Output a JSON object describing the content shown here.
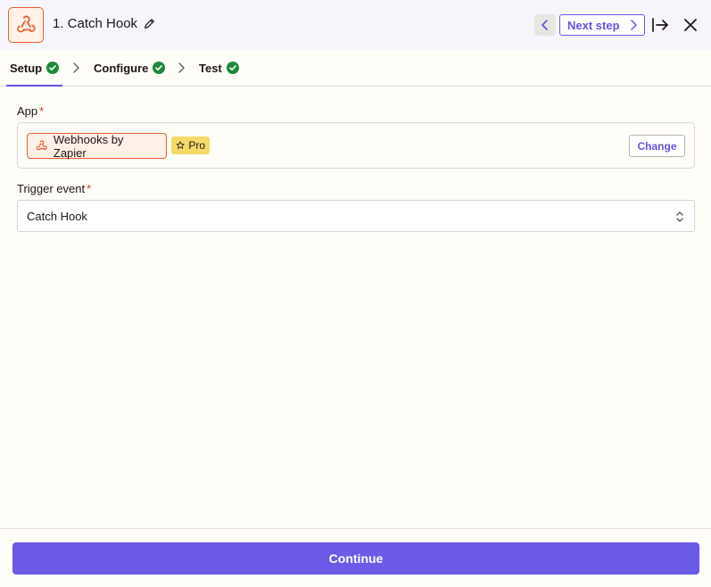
{
  "header": {
    "step_title": "1. Catch Hook",
    "next_step_label": "Next step",
    "colors": {
      "accent": "#6553e0",
      "brand": "#e85f2a"
    }
  },
  "tabs": [
    {
      "label": "Setup",
      "status": "complete",
      "active": true
    },
    {
      "label": "Configure",
      "status": "complete",
      "active": false
    },
    {
      "label": "Test",
      "status": "complete",
      "active": false
    }
  ],
  "form": {
    "app_label": "App",
    "app_required_mark": "*",
    "app_value": "Webhooks by Zapier",
    "pro_badge": "Pro",
    "change_label": "Change",
    "trigger_label": "Trigger event",
    "trigger_required_mark": "*",
    "trigger_value": "Catch Hook"
  },
  "footer": {
    "continue_label": "Continue"
  },
  "icons": [
    "webhook-icon",
    "pencil-icon",
    "chevron-left-icon",
    "chevron-right-icon",
    "expand-right-icon",
    "close-icon",
    "check-circle-icon",
    "star-icon",
    "updown-chevron-icon"
  ]
}
